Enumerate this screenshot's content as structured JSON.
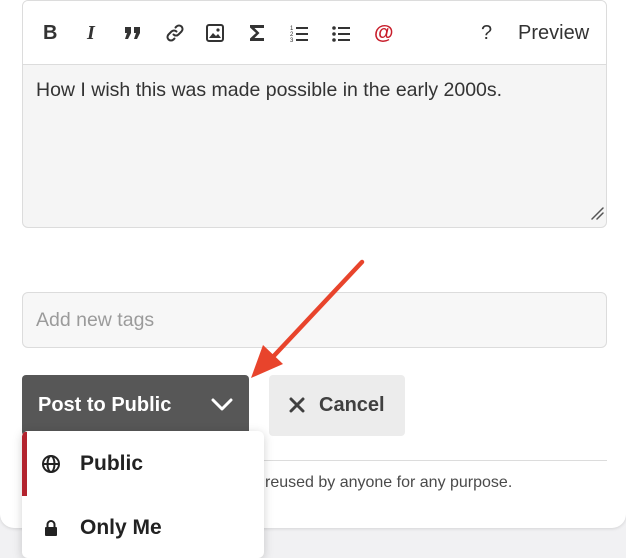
{
  "toolbar": {
    "bold": "B",
    "italic": "I",
    "mention": "@",
    "help": "?",
    "preview": "Preview"
  },
  "editor": {
    "content": "How I wish this was made possible in the early 2000s."
  },
  "tags": {
    "placeholder": "Add new tags"
  },
  "actions": {
    "post_label": "Post to Public",
    "cancel_label": "Cancel"
  },
  "license_text": "reused by anyone for any purpose.",
  "visibility_menu": {
    "items": [
      {
        "label": "Public",
        "icon": "globe-icon",
        "selected": true
      },
      {
        "label": "Only Me",
        "icon": "lock-icon",
        "selected": false
      }
    ]
  },
  "colors": {
    "accent": "#b3232e",
    "annotation_arrow": "#e8442c",
    "primary_button": "#575757"
  }
}
